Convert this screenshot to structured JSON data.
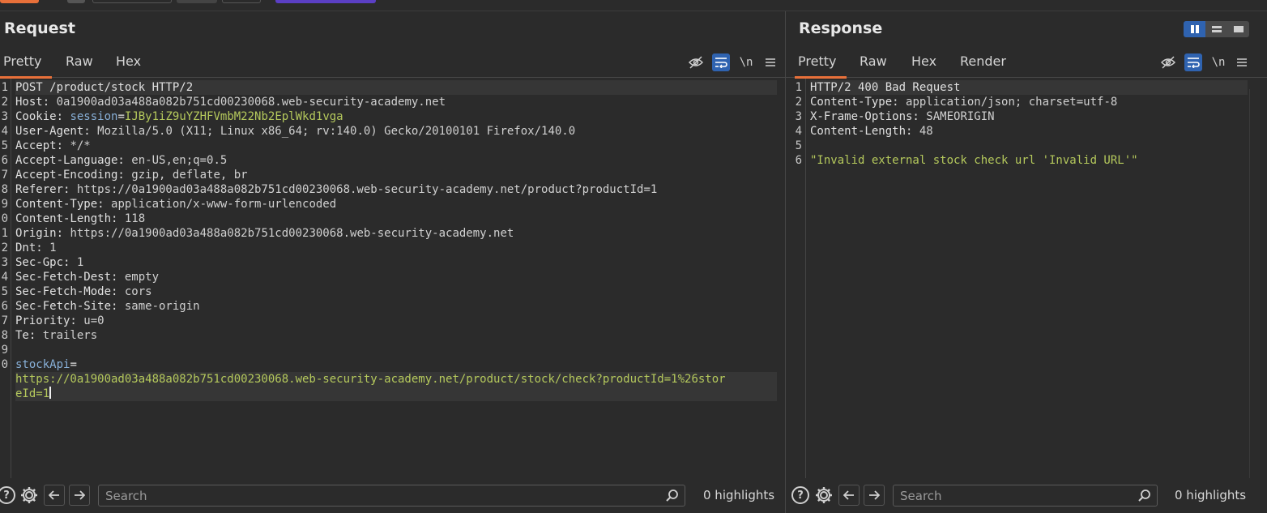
{
  "request": {
    "title": "Request",
    "tabs": [
      "Pretty",
      "Raw",
      "Hex"
    ],
    "active_tab": "Pretty",
    "line_numbers": [
      "1",
      "2",
      "3",
      "4",
      "5",
      "6",
      "7",
      "8",
      "9",
      "0",
      "1",
      "2",
      "3",
      "4",
      "5",
      "6",
      "7",
      "8",
      "9",
      "0"
    ],
    "lines": [
      {
        "k": "POST /product/stock HTTP/2",
        "v": ""
      },
      {
        "k": "Host: ",
        "v": "0a1900ad03a488a082b751cd00230068.web-security-academy.net"
      },
      {
        "k": "Cookie: ",
        "b": "session",
        "eq": "=",
        "g": "IJBy1iZ9uYZHFVmbM22Nb2EplWkd1vga"
      },
      {
        "k": "User-Agent: ",
        "v": "Mozilla/5.0 (X11; Linux x86_64; rv:140.0) Gecko/20100101 Firefox/140.0"
      },
      {
        "k": "Accept: ",
        "v": "*/*"
      },
      {
        "k": "Accept-Language: ",
        "v": "en-US,en;q=0.5"
      },
      {
        "k": "Accept-Encoding: ",
        "v": "gzip, deflate, br"
      },
      {
        "k": "Referer: ",
        "v": "https://0a1900ad03a488a082b751cd00230068.web-security-academy.net/product?productId=1"
      },
      {
        "k": "Content-Type: ",
        "v": "application/x-www-form-urlencoded"
      },
      {
        "k": "Content-Length: ",
        "v": "118"
      },
      {
        "k": "Origin: ",
        "v": "https://0a1900ad03a488a082b751cd00230068.web-security-academy.net"
      },
      {
        "k": "Dnt: ",
        "v": "1"
      },
      {
        "k": "Sec-Gpc: ",
        "v": "1"
      },
      {
        "k": "Sec-Fetch-Dest: ",
        "v": "empty"
      },
      {
        "k": "Sec-Fetch-Mode: ",
        "v": "cors"
      },
      {
        "k": "Sec-Fetch-Site: ",
        "v": "same-origin"
      },
      {
        "k": "Priority: ",
        "v": "u=0"
      },
      {
        "k": "Te: ",
        "v": "trailers"
      },
      {
        "k": "",
        "v": ""
      },
      {
        "b": "stockApi",
        "eq": "=",
        "g": ""
      }
    ],
    "body_wrap_1": "https://0a1900ad03a488a082b751cd00230068.web-security-academy.net/product/stock/check?productId=1%26stor",
    "body_wrap_2": "eId=1"
  },
  "response": {
    "title": "Response",
    "tabs": [
      "Pretty",
      "Raw",
      "Hex",
      "Render"
    ],
    "active_tab": "Pretty",
    "line_numbers": [
      "1",
      "2",
      "3",
      "4",
      "5",
      "6"
    ],
    "lines": [
      {
        "k": "HTTP/2 400 Bad Request",
        "v": ""
      },
      {
        "k": "Content-Type: ",
        "v": "application/json; charset=utf-8"
      },
      {
        "k": "X-Frame-Options: ",
        "v": "SAMEORIGIN"
      },
      {
        "k": "Content-Length: ",
        "v": "48"
      },
      {
        "k": "",
        "v": ""
      },
      {
        "g": "\"Invalid external stock check url 'Invalid URL'\""
      }
    ]
  },
  "toolbar": {
    "newline_label": "\\n"
  },
  "search": {
    "placeholder": "Search",
    "highlights_label": "0 highlights"
  },
  "colors": {
    "accent_tab": "#e8703a",
    "toggle_on": "#2f63b0",
    "string_green": "#b5c95c"
  }
}
